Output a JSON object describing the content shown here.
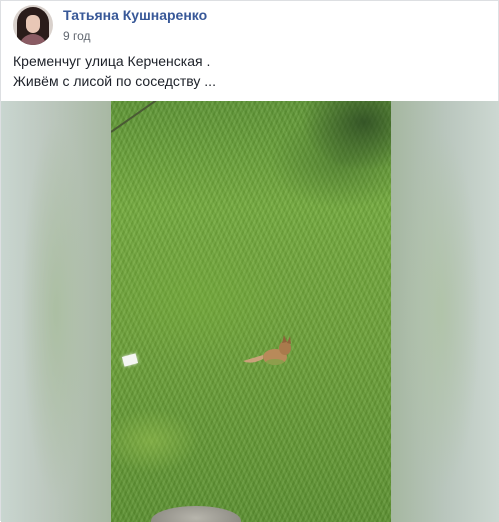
{
  "post": {
    "author": "Татьяна Кушнаренко",
    "timestamp": "9 год",
    "text_lines": [
      "Кременчуг улица Керченская .",
      "Живём с лисой по соседству ..."
    ]
  },
  "media": {
    "type": "video-frame",
    "subject": "fox on grass"
  },
  "colors": {
    "author_link": "#385898",
    "text": "#1d2129",
    "meta": "#616770",
    "grass": "#6ea23a"
  }
}
